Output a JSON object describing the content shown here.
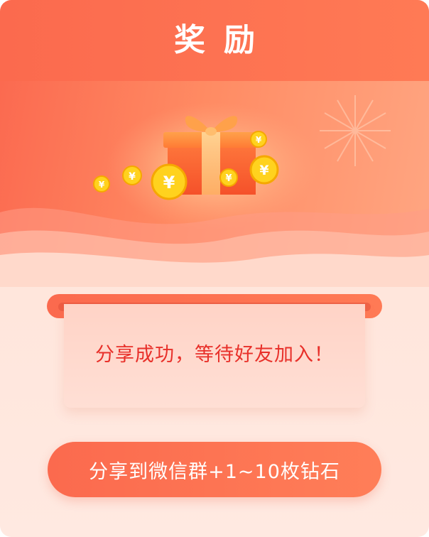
{
  "header": {
    "title": "奖励"
  },
  "message": {
    "text": "分享成功，等待好友加入！"
  },
  "share_button": {
    "label": "分享到微信群+1~10枚钻石"
  },
  "colors": {
    "accent": "#fb6a4e",
    "message_text": "#e8302a",
    "gift_box": "#ff6a3d",
    "coin": "#ffd21e"
  },
  "icons": {
    "banner": "gift-box-icon",
    "coins": "yuan-coin-icon"
  }
}
